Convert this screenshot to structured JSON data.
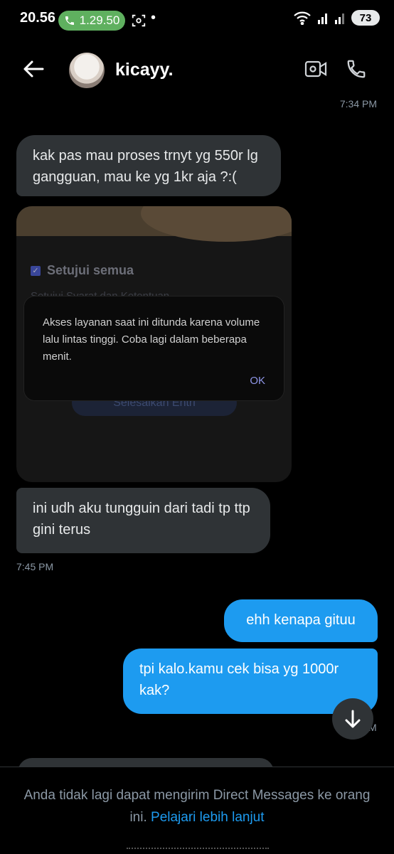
{
  "status_bar": {
    "time": "20.56",
    "call_timer": "1.29.50",
    "battery": "73",
    "dot": "•"
  },
  "header": {
    "username": "kicayy.",
    "icons": [
      "back-arrow-icon",
      "video-call-icon",
      "phone-call-icon"
    ]
  },
  "messages": [
    {
      "type": "timestamp",
      "text": "7:34 PM"
    },
    {
      "type": "incoming",
      "text": "kak pas mau proses trnyt yg 550r lg gangguan, mau ke yg 1kr aja ?:("
    },
    {
      "type": "incoming-image",
      "screenshot": {
        "checkbox_label": "Setujui semua",
        "partial_line": "Setujui Syarat dan Ketentuan",
        "button_label": "Selesaikan Entri",
        "dialog_message": "Akses layanan saat ini ditunda karena volume lalu lintas tinggi. Coba lagi dalam beberapa menit.",
        "dialog_button": "OK"
      }
    },
    {
      "type": "incoming",
      "text": "ini udh aku tungguin dari tadi tp ttp gini terus"
    },
    {
      "type": "timestamp",
      "text": "7:45 PM"
    },
    {
      "type": "outgoing",
      "text": "ehh kenapa gituu"
    },
    {
      "type": "outgoing",
      "text": "tpi kalo.kamu cek bisa yg 1000r kak?"
    },
    {
      "type": "timestamp-partial",
      "text": "M"
    }
  ],
  "footer": {
    "notice": "Anda tidak lagi dapat mengirim Direct Messages ke orang ini.",
    "link": "Pelajari lebih lanjut"
  },
  "colors": {
    "background": "#000000",
    "incoming_bubble": "#2f3336",
    "outgoing_bubble": "#1d9bf0",
    "secondary_text": "#8b98a5",
    "call_pill": "#5fb05f"
  }
}
